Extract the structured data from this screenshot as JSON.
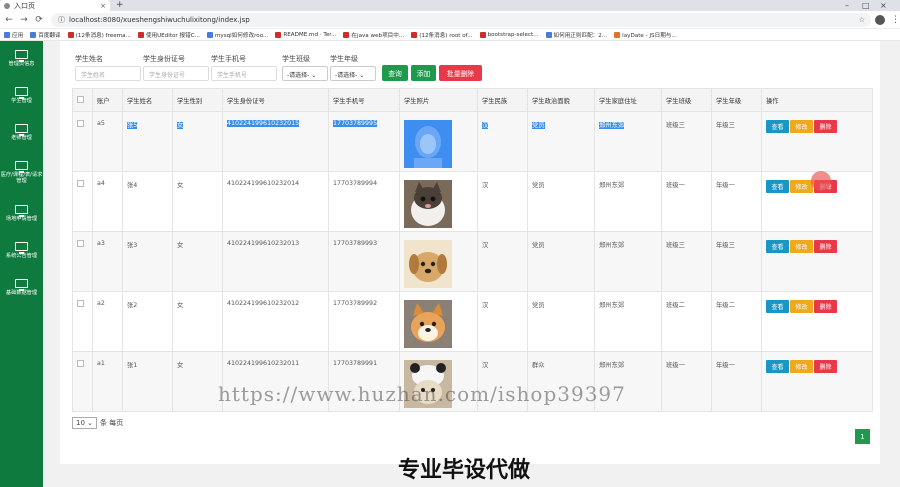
{
  "browser": {
    "tab_title": "入口页",
    "url": "localhost:8080/xueshengshiwuchulixitong/index.jsp",
    "bookmarks": [
      "应用",
      "百度翻译",
      "(12条消息) freema...",
      "使用UEditor 报错C...",
      "mysql如何修改roo...",
      "README.md · Ter...",
      "在java web项目中...",
      "(12条消息) root of...",
      "bootstrap-select...",
      "如何用正则匹配：2...",
      "layDate - JS日期与..."
    ]
  },
  "sidebar": {
    "items": [
      "管理员信息",
      "学生管理",
      "老师管理",
      "医疗/课程/表/请求管理",
      "场地申请管理",
      "系统公告管理",
      "基础数据管理"
    ]
  },
  "search": {
    "name_label": "学生姓名",
    "name_placeholder": "学生姓名",
    "idcard_label": "学生身份证号",
    "idcard_placeholder": "学生身份证号",
    "phone_label": "学生手机号",
    "phone_placeholder": "学生手机号",
    "class_label": "学生班级",
    "class_value": "-请选择-",
    "grade_label": "学生年级",
    "grade_value": "-请选择-",
    "query_button": "查询",
    "add_button": "添加",
    "batch_delete_button": "批量删除"
  },
  "table": {
    "headers": [
      "",
      "账户",
      "学生姓名",
      "学生性别",
      "学生身份证号",
      "学生手机号",
      "学生照片",
      "学生民族",
      "学生政治面貌",
      "学生家庭住址",
      "学生班级",
      "学生年级",
      "操作"
    ],
    "op_labels": {
      "view": "查看",
      "edit": "修改",
      "delete": "删除"
    },
    "rows": [
      {
        "account": "a5",
        "name": "张5",
        "gender": "女",
        "idcard": "410224199610232015",
        "phone": "17703789995",
        "nation": "汉",
        "politics": "党员",
        "address": "郑州东郊",
        "class": "班级三",
        "grade": "年级三",
        "photo": "girl-portrait"
      },
      {
        "account": "a4",
        "name": "张4",
        "gender": "女",
        "idcard": "410224199610232014",
        "phone": "17703789994",
        "nation": "汉",
        "politics": "党员",
        "address": "郑州东郊",
        "class": "班级一",
        "grade": "年级一",
        "photo": "cat"
      },
      {
        "account": "a3",
        "name": "张3",
        "gender": "女",
        "idcard": "410224199610232013",
        "phone": "17703789993",
        "nation": "汉",
        "politics": "党员",
        "address": "郑州东郊",
        "class": "班级三",
        "grade": "年级三",
        "photo": "puppy"
      },
      {
        "account": "a2",
        "name": "张2",
        "gender": "女",
        "idcard": "410224199610232012",
        "phone": "17703789992",
        "nation": "汉",
        "politics": "党员",
        "address": "郑州东郊",
        "class": "班级二",
        "grade": "年级二",
        "photo": "shiba-dog"
      },
      {
        "account": "a1",
        "name": "张1",
        "gender": "女",
        "idcard": "410224199610232011",
        "phone": "17703789991",
        "nation": "汉",
        "politics": "群众",
        "address": "郑州东郊",
        "class": "班级一",
        "grade": "年级一",
        "photo": "panda-hat-dog"
      }
    ]
  },
  "pager": {
    "page_size": "10",
    "per_page_label": "条 每页",
    "current_page": "1"
  },
  "overlay": {
    "watermark": "https://www.huzhan.com/ishop39397",
    "caption": "专业毕设代做"
  },
  "colors": {
    "sidebar": "#0e7a3e",
    "primary": "#1e9a4c",
    "danger": "#e8394a",
    "info": "#1996c8",
    "warning": "#f0a91a",
    "selection": "#3b8ee8"
  }
}
